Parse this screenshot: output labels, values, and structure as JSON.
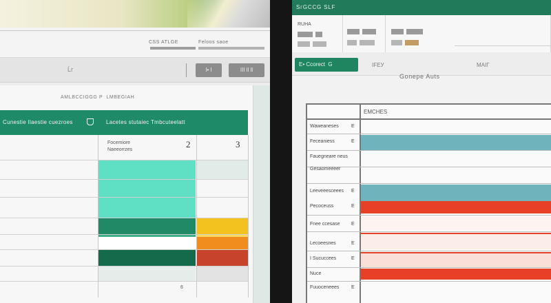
{
  "left": {
    "ribbon": {
      "tabs": [
        "CSS ATLGE",
        "Feloos saoe"
      ]
    },
    "toolbar": {
      "mark": "Ĺг",
      "btn1": "I• I",
      "btn2": "III ll ll"
    },
    "sheet": {
      "subheads": [
        "AMLBCCIGGG",
        "P  LMBEGIAH"
      ],
      "banner": {
        "left": "Cunestie Ilaestie cuezroes",
        "right": "Lacetes stutaiec Tmbcuteelatt"
      },
      "header": {
        "label_line1": "Focemiore",
        "label_line2": "Naeeorrzes",
        "num1": "2",
        "num2": "3"
      },
      "footer_mark": "6"
    },
    "colors": {
      "green_dark": "#1e8a68",
      "mint": "#5fe0c4",
      "yellow": "#f4c21f",
      "orange": "#ef8d1f",
      "red": "#c7432b"
    }
  },
  "right": {
    "title": "SгGCCG SLF",
    "tabs": [
      "RUHA",
      "",
      ""
    ],
    "toolbar": {
      "green_btn": "E• Ccorect  G",
      "mark1": "IFEУ",
      "mark2": "MAIГ"
    },
    "caption": "Gonepe Auts",
    "table": {
      "header": "EMCHES",
      "rows": [
        {
          "label": "Waweaneses",
          "suffix": "E"
        },
        {
          "label": "Feceaniess",
          "suffix": "E"
        },
        {
          "label": "Fauegneare neus",
          "suffix": ""
        },
        {
          "label": "Gesaomeeeer",
          "suffix": ""
        },
        {
          "label": "Leeveeesceees",
          "suffix": "E"
        },
        {
          "label": "Pecoceuss",
          "suffix": "E"
        },
        {
          "label": "Fnee ccesase",
          "suffix": "E"
        },
        {
          "label": "Lecoeesnes",
          "suffix": "E"
        },
        {
          "label": "I Sucuccees",
          "suffix": "E"
        },
        {
          "label": "Nuce",
          "suffix": ""
        },
        {
          "label": "Fuuoceneees",
          "suffix": "E"
        }
      ]
    },
    "colors": {
      "teal": "#6fb4bd",
      "red": "#e64027",
      "light_red": "#f8e0d8"
    }
  }
}
